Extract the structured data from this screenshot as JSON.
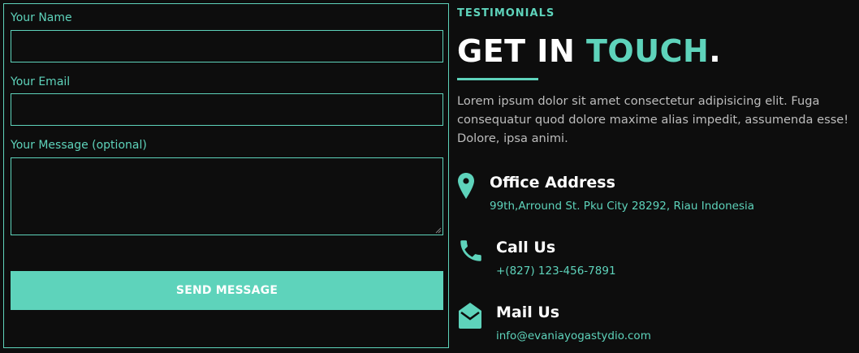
{
  "form": {
    "name_label": "Your Name",
    "name_value": "",
    "email_label": "Your Email",
    "email_value": "",
    "message_label": "Your Message (optional)",
    "message_value": "",
    "send_label": "SEND MESSAGE"
  },
  "contact": {
    "tag": "TESTIMONIALS",
    "heading_part1": "GET IN ",
    "heading_accent": "TOUCH",
    "heading_end": ".",
    "intro": "Lorem ipsum dolor sit amet consectetur adipisicing elit. Fuga consequatur quod dolore maxime alias impedit, assumenda esse! Dolore, ipsa animi.",
    "items": [
      {
        "icon": "map-pin-icon",
        "title": "Office Address",
        "detail": "99th,Arround St. Pku City 28292, Riau Indonesia"
      },
      {
        "icon": "phone-icon",
        "title": "Call Us",
        "detail": "+(827) 123-456-7891"
      },
      {
        "icon": "envelope-open-icon",
        "title": "Mail Us",
        "detail": "info@evaniayogastydio.com"
      }
    ]
  },
  "colors": {
    "background": "#0d0d0d",
    "accent": "#5ed3bb",
    "text": "#ffffff",
    "muted": "#bdbdbd"
  }
}
